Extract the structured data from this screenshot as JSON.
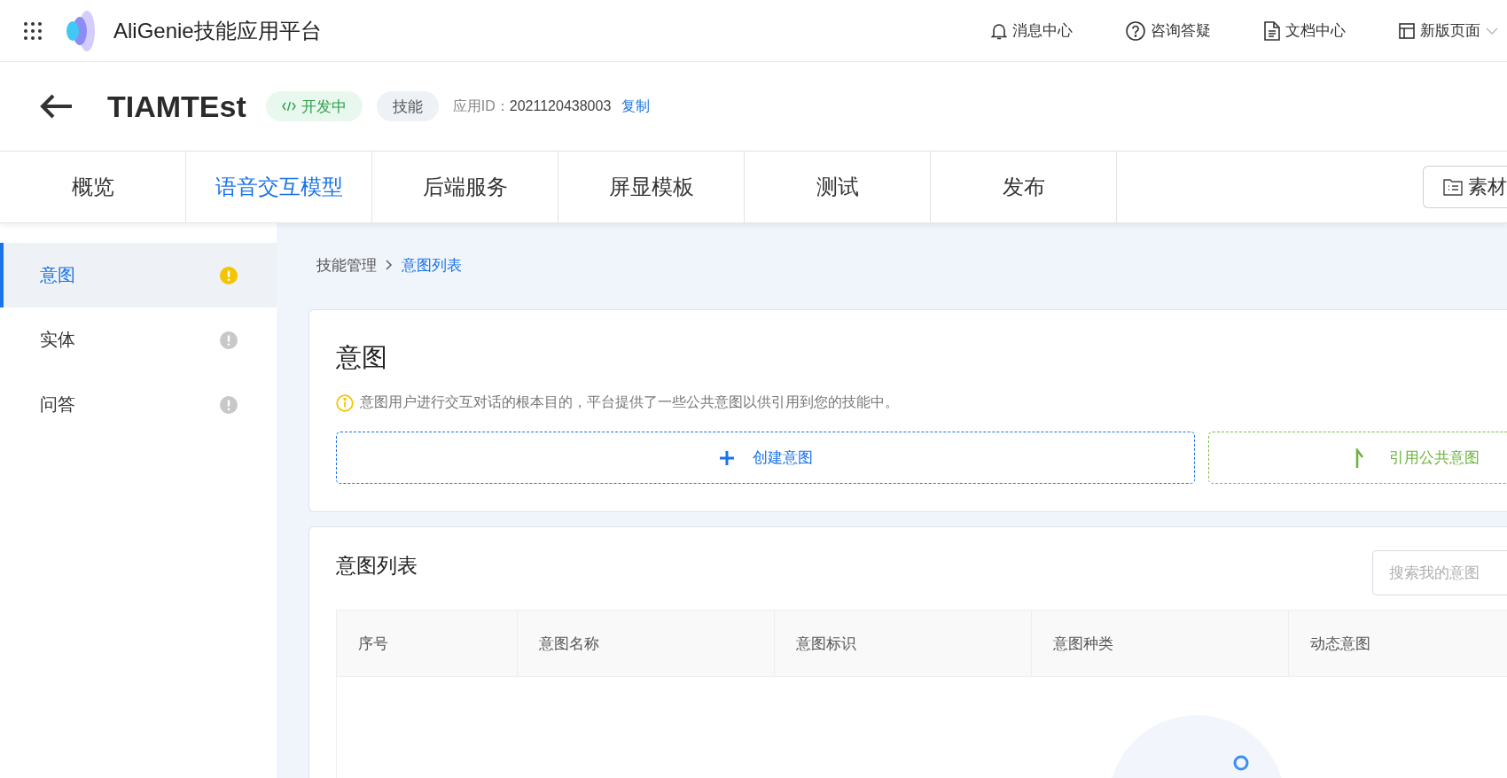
{
  "top_bar": {
    "title": "AliGenie技能应用平台",
    "links": [
      {
        "label": "消息中心",
        "kind": "bell",
        "dropdown": false
      },
      {
        "label": "咨询答疑",
        "kind": "help",
        "dropdown": false
      },
      {
        "label": "文档中心",
        "kind": "document",
        "dropdown": false
      },
      {
        "label": "新版页面",
        "kind": "layout",
        "dropdown": true
      }
    ]
  },
  "header": {
    "title": "TIAMTEst",
    "status": "开发中",
    "tag": "技能",
    "id_label": "应用ID：",
    "id_value": "2021120438003",
    "copy": "复制"
  },
  "tabs": [
    {
      "label": "概览",
      "selected": false
    },
    {
      "label": "语音交互模型",
      "selected": true
    },
    {
      "label": "后端服务",
      "selected": false
    },
    {
      "label": "屏显模板",
      "selected": false
    },
    {
      "label": "测试",
      "selected": false
    },
    {
      "label": "发布",
      "selected": false
    }
  ],
  "materials_button": "素材",
  "sidebar": {
    "items": [
      {
        "label": "意图",
        "selected": true,
        "color": "#f5c400"
      },
      {
        "label": "实体",
        "selected": false,
        "color": "#c8c8c8"
      },
      {
        "label": "问答",
        "selected": false,
        "color": "#c8c8c8"
      }
    ]
  },
  "breadcrumb": [
    {
      "label": "技能管理",
      "current": false
    },
    {
      "label": "意图列表",
      "current": true
    }
  ],
  "intent_card": {
    "title": "意图",
    "note": "意图用户进行交互对话的根本目的，平台提供了一些公共意图以供引用到您的技能中。",
    "buttons": [
      {
        "label": "创建意图",
        "kind": "create"
      },
      {
        "label": "引用公共意图",
        "kind": "reference"
      }
    ]
  },
  "intent_list": {
    "title": "意图列表",
    "search": {
      "placeholder": "搜索我的意图"
    },
    "columns": [
      "序号",
      "意图名称",
      "意图标识",
      "意图种类",
      "动态意图"
    ]
  }
}
